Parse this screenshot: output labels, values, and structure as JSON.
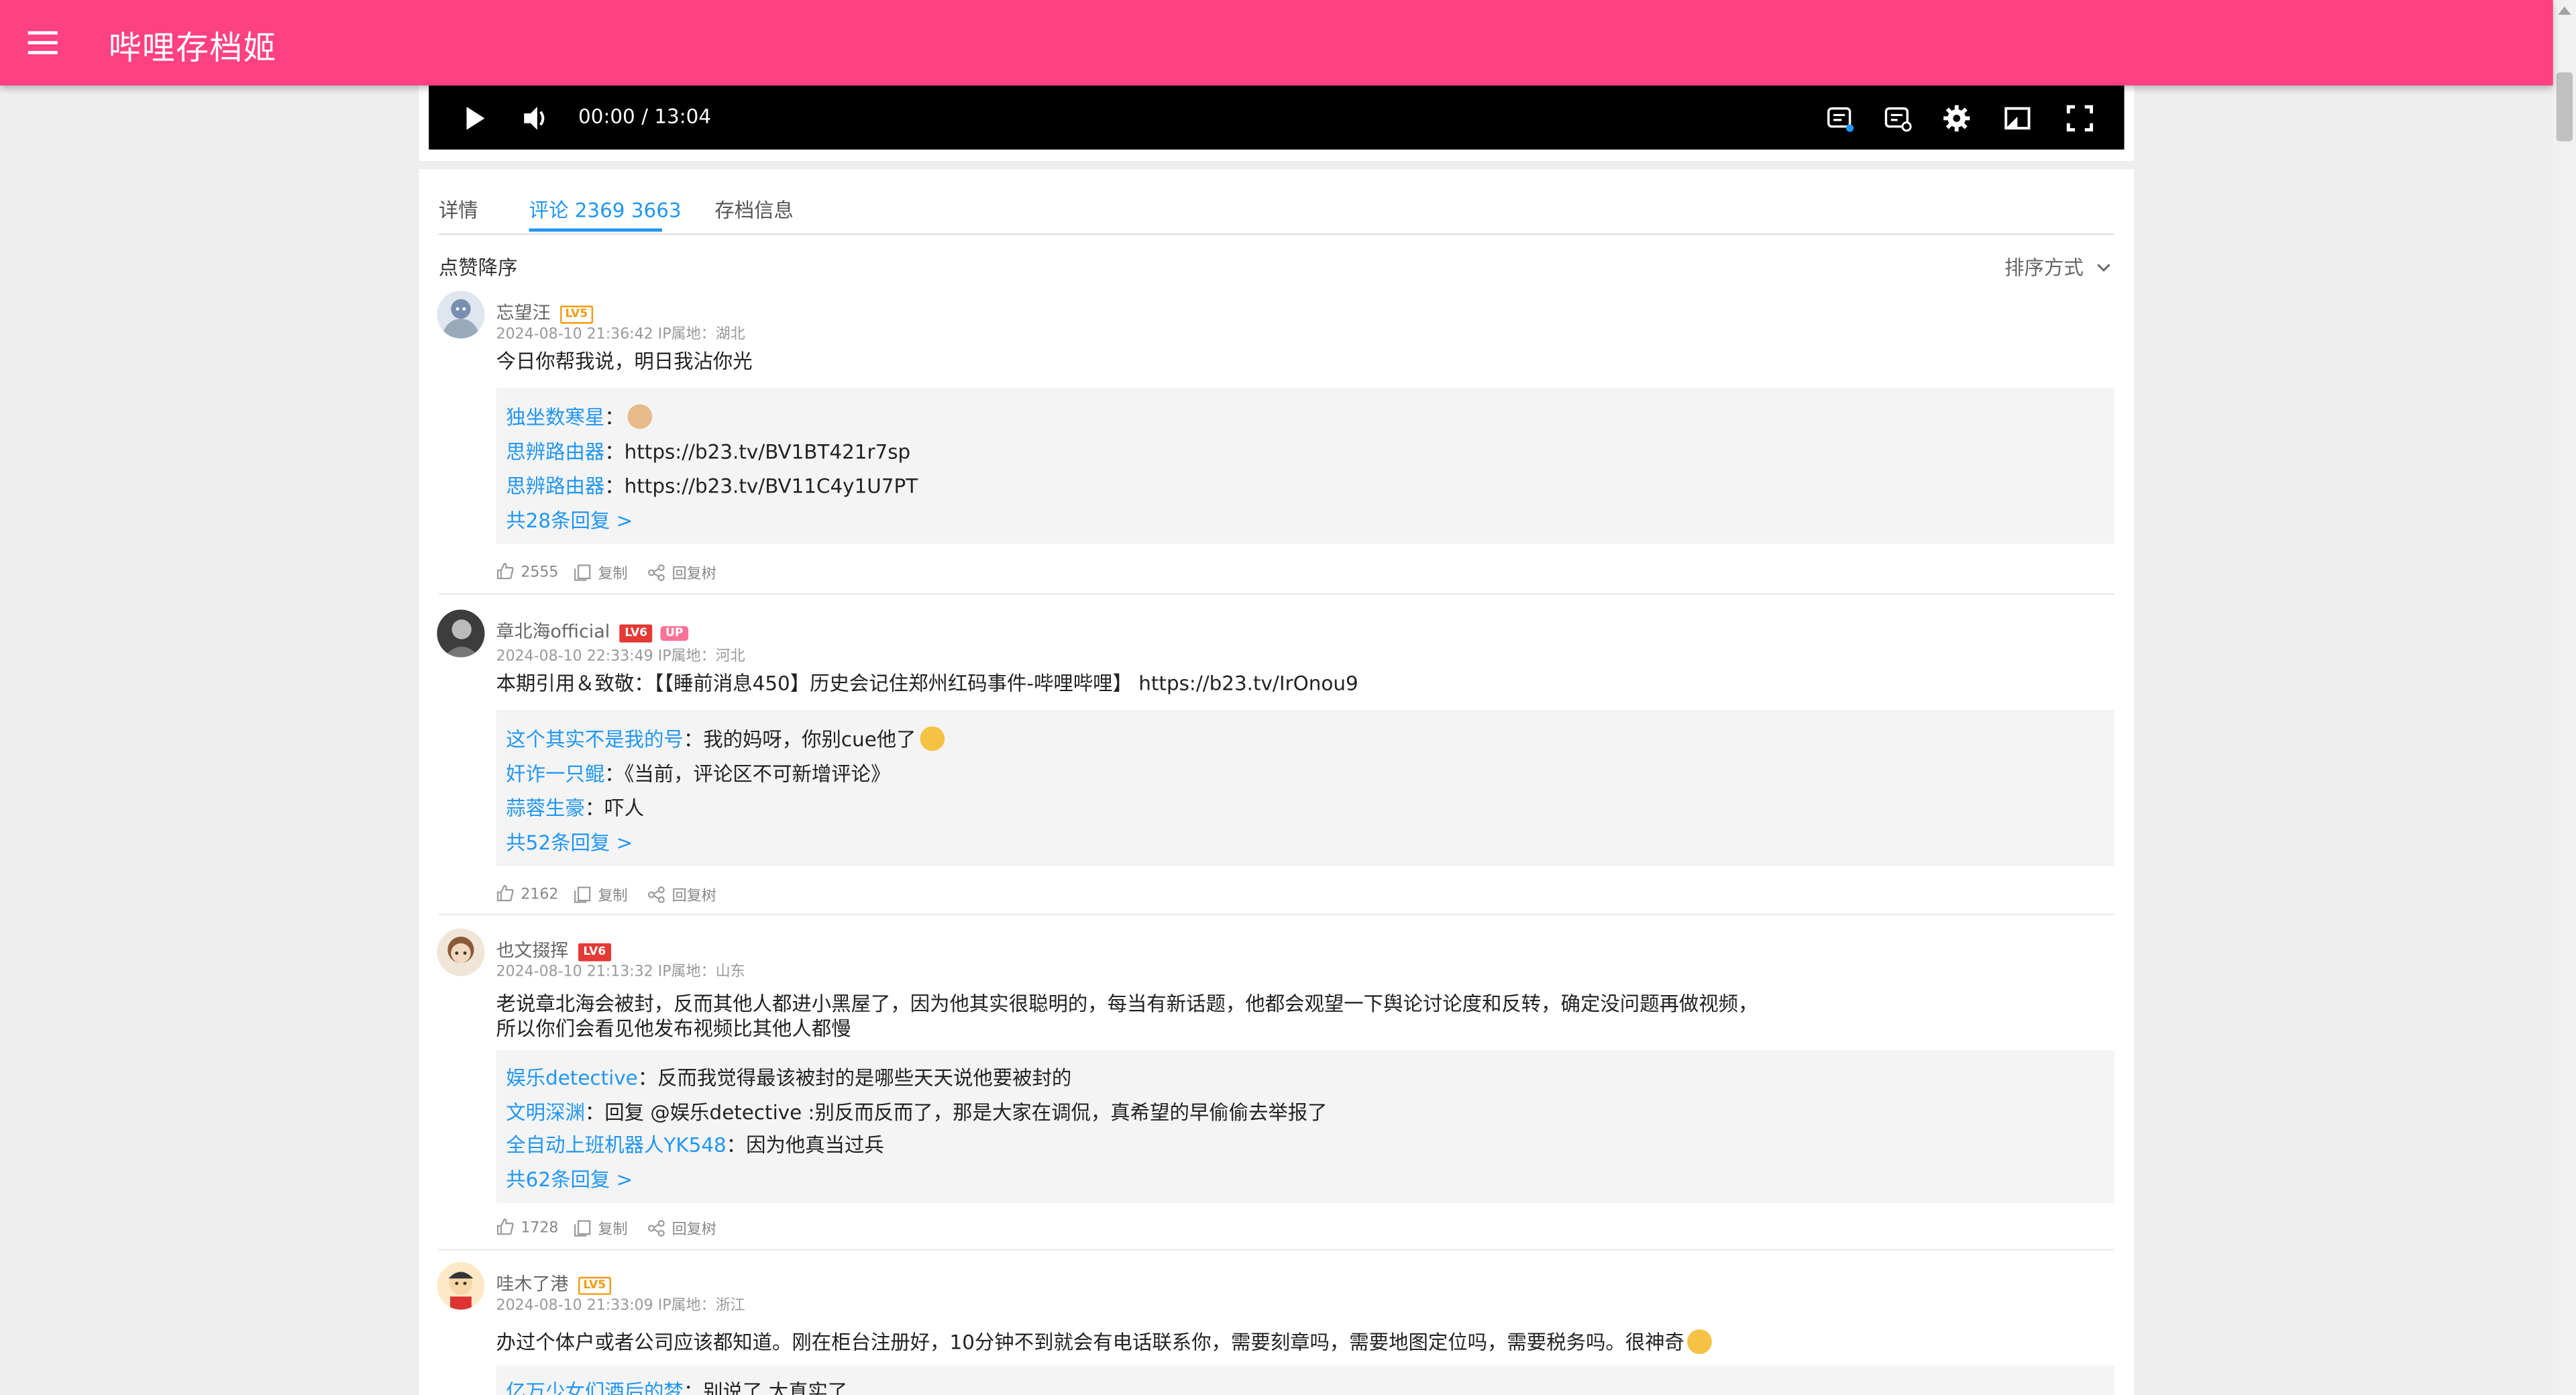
{
  "app": {
    "title": "哔哩存档姬"
  },
  "player": {
    "time": "00:00 / 13:04"
  },
  "tabs": [
    {
      "label": "详情"
    },
    {
      "label": "评论 2369 3663"
    },
    {
      "label": "存档信息"
    }
  ],
  "sort": {
    "label": "点赞降序",
    "select_label": "排序方式"
  },
  "colors": {
    "appbar": "#ff4081",
    "accent": "#2196f3",
    "level5": "#f39c12",
    "level6": "#e53935",
    "up_badge": "#fb7299"
  },
  "comments": [
    {
      "username": "忘望汪",
      "level": "LV5",
      "meta": "2024-08-10 21:36:42  IP属地：湖北",
      "text": "今日你帮我说，明日我沾你光",
      "replies": [
        {
          "name": "独坐数寒星",
          "text": "："
        },
        {
          "name": "思辨路由器",
          "text": "：https://b23.tv/BV1BT421r7sp"
        },
        {
          "name": "思辨路由器",
          "text": "：https://b23.tv/BV11C4y1U7PT"
        }
      ],
      "more": "共28条回复 >",
      "likes": "2555",
      "copy": "复制",
      "tree": "回复树"
    },
    {
      "username": "章北海official",
      "level": "LV6",
      "up": "UP",
      "meta": "2024-08-10 22:33:49  IP属地：河北",
      "text": "本期引用＆致敬：【【睡前消息450】历史会记住郑州红码事件-哔哩哔哩】 https://b23.tv/IrOnou9",
      "replies": [
        {
          "name": "这个其实不是我的号",
          "text": "：我的妈呀，你别cue他了"
        },
        {
          "name": "奸诈一只鲲",
          "text": "：《当前，评论区不可新增评论》"
        },
        {
          "name": "蒜蓉生豪",
          "text": "：吓人"
        }
      ],
      "more": "共52条回复 >",
      "likes": "2162",
      "copy": "复制",
      "tree": "回复树"
    },
    {
      "username": "也文掇挥",
      "level": "LV6",
      "meta": "2024-08-10 21:13:32  IP属地：山东",
      "text": "老说章北海会被封，反而其他人都进小黑屋了，因为他其实很聪明的，每当有新话题，他都会观望一下舆论讨论度和反转，确定没问题再做视频，",
      "text2": "所以你们会看见他发布视频比其他人都慢",
      "replies": [
        {
          "name": "娱乐detective",
          "text": "：反而我觉得最该被封的是哪些天天说他要被封的"
        },
        {
          "name": "文明深渊",
          "text": "：回复 @娱乐detective :别反而反而了，那是大家在调侃，真希望的早偷偷去举报了"
        },
        {
          "name": "全自动上班机器人YK548",
          "text": "：因为他真当过兵"
        }
      ],
      "more": "共62条回复 >",
      "likes": "1728",
      "copy": "复制",
      "tree": "回复树"
    },
    {
      "username": "哇木了港",
      "level": "LV5",
      "meta": "2024-08-10 21:33:09  IP属地：浙江",
      "text": "办过个体户或者公司应该都知道。刚在柜台注册好，10分钟不到就会有电话联系你，需要刻章吗，需要地图定位吗，需要税务吗。很神奇",
      "replies": [
        {
          "name": "亿万少女们酒后的梦",
          "text": "：别说了,太真实了"
        }
      ]
    }
  ]
}
